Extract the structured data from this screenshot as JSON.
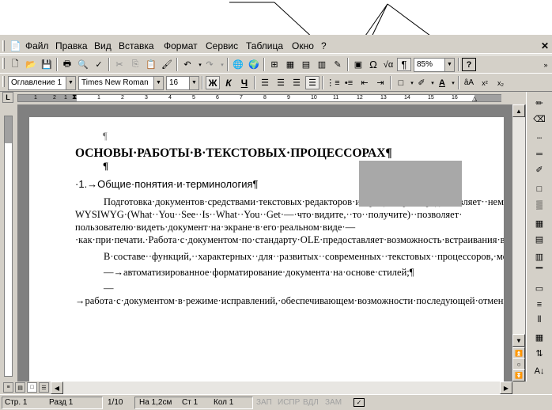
{
  "menu": {
    "items": [
      {
        "label": "Файл",
        "key": "Ф"
      },
      {
        "label": "Правка",
        "key": "П"
      },
      {
        "label": "Вид",
        "key": "В"
      },
      {
        "label": "Вставка",
        "key": "т"
      },
      {
        "label": "Формат",
        "key": "м"
      },
      {
        "label": "Сервис",
        "key": "С"
      },
      {
        "label": "Таблица",
        "key": "Т"
      },
      {
        "label": "Окно",
        "key": "О"
      },
      {
        "label": "?",
        "key": "?"
      }
    ]
  },
  "standard_toolbar": {
    "zoom": "85%",
    "show_marks": "¶"
  },
  "format_toolbar": {
    "style": "Оглавление 1",
    "font": "Times New Roman",
    "size": "16",
    "bold": "Ж",
    "italic": "К",
    "underline": "Ч"
  },
  "ruler": {
    "numbers": [
      "1",
      "2",
      "1",
      "1",
      "2",
      "3",
      "4",
      "5",
      "6",
      "7",
      "8",
      "9",
      "10",
      "11",
      "12",
      "13",
      "14",
      "15",
      "16"
    ]
  },
  "document": {
    "empty_mark": "¶",
    "title": "ОСНОВЫ·РАБОТЫ·В·ТЕКСТОВЫХ·ПРОЦЕССОРАХ¶",
    "section": "1.→Общие·понятия·и·терминология¶",
    "paragraph1": "Подготовка·документов·средствами·текстовых·редакторов·и·процессоров·предоставляет··немыслимые··недавно··удобства··и··возможности.··К··примеру,··режим· WYSIWYG·(What··You··See··Is··What··You··Get·—·что·видите,··то··получите)··позволяет· пользователю·видеть·документ·на·экране·в·его·реальном·виде·—·как·при·печати.·Работа·с·документом·по·стандарту·OLE·предоставляет·возможность·встраивания·в·документ·объектов·из·других·приложений·(к·примеру,·табличных·процессоров,·графических·редакторов,·систем·управления·базами·данных)·с·возможностью·вызова·последних·для·обработки·связанных·объектов.¶",
    "paragraph2": "В·составе··функций,··характерных··для··развитых··современных··текстовых··процессоров,·можно·назвать·следующие:·¶",
    "bullet1": "—→автоматизированное·форматирование·документа·на·основе·стилей;¶",
    "bullet2": "—→работа·с·документом·в·режиме·исправлений,·обеспечивающем·возможности·последующей·отмены·или·подтверждения·каждого·изменения;¶"
  },
  "status": {
    "page": "Стр.  1",
    "section": "Разд  1",
    "pages": "1/10",
    "at": "На 1,2см",
    "line": "Ст  1",
    "col": "Кол  1",
    "rec": "ЗАП",
    "trk": "ИСПР",
    "ext": "ВДЛ",
    "ovr": "ЗАМ"
  }
}
